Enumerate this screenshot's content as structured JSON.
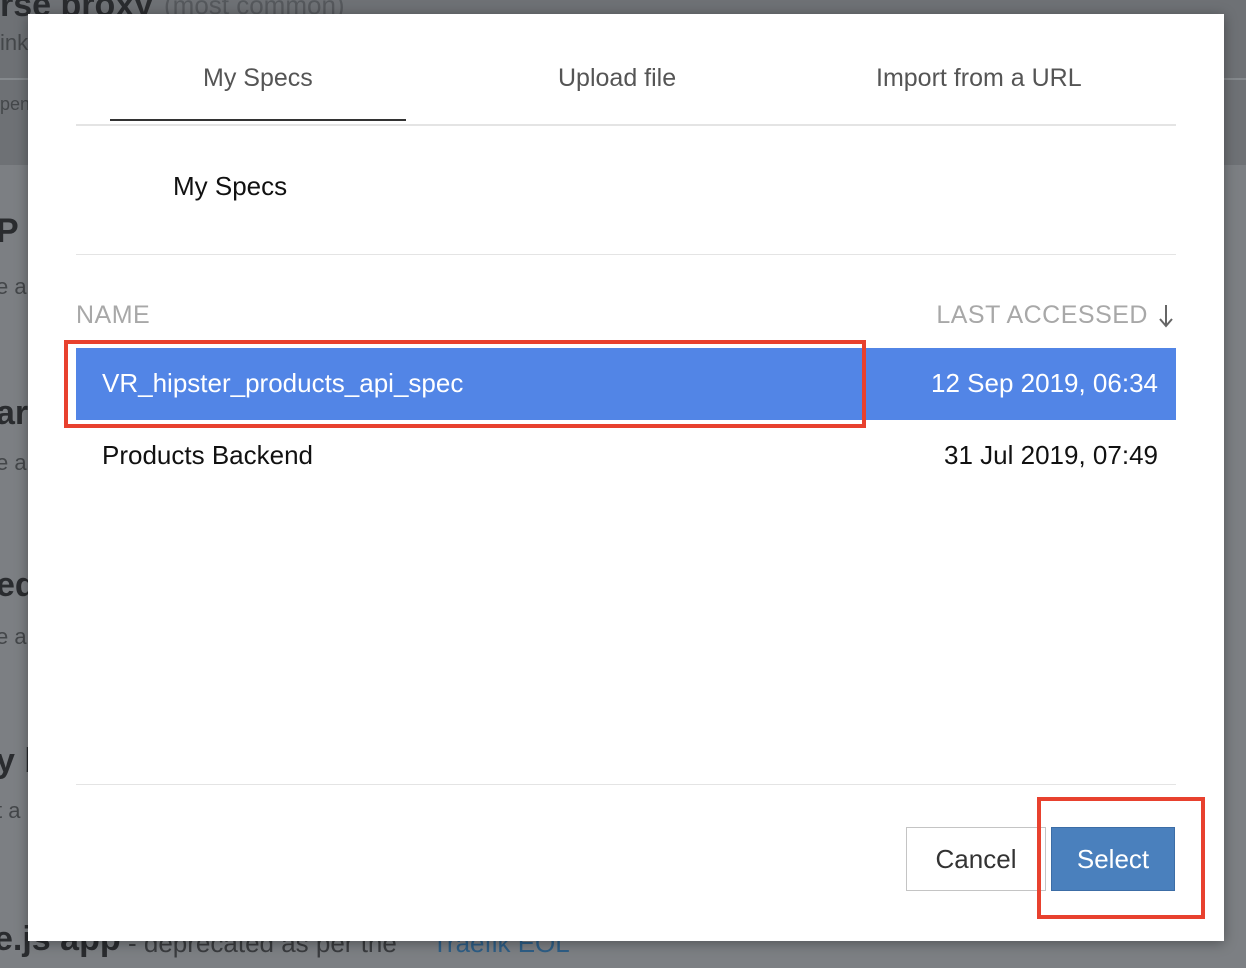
{
  "background": {
    "fragments": [
      "rse proxy",
      "(most common)",
      "ink",
      "pen",
      "P s",
      "e a",
      "ar",
      "e a",
      "ed",
      "e a",
      "y b",
      "t a",
      "e.js app",
      "- deprecated as per the",
      "Traefik EOL"
    ]
  },
  "modal": {
    "tabs": [
      {
        "label": "My Specs",
        "active": true
      },
      {
        "label": "Upload file",
        "active": false
      },
      {
        "label": "Import from a URL",
        "active": false
      }
    ],
    "section_title": "My Specs",
    "columns": {
      "name": "NAME",
      "last_accessed": "LAST ACCESSED",
      "sort_icon": "arrow-down-icon"
    },
    "rows": [
      {
        "name": "VR_hipster_products_api_spec",
        "last_accessed": "12 Sep 2019, 06:34",
        "selected": true
      },
      {
        "name": "Products Backend",
        "last_accessed": "31 Jul 2019, 07:49",
        "selected": false
      }
    ],
    "buttons": {
      "cancel": "Cancel",
      "select": "Select"
    }
  },
  "colors": {
    "selected_row": "#5285e6",
    "select_button": "#4a80bd",
    "annotation": "#e8412e"
  }
}
